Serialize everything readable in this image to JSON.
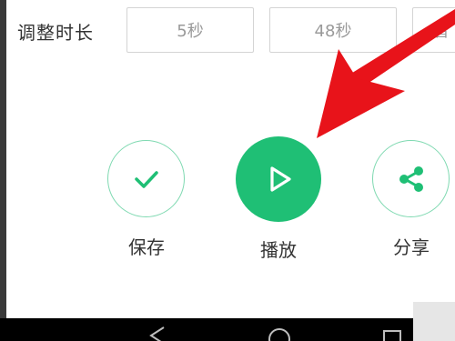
{
  "duration": {
    "label": "调整时长",
    "options": [
      "5秒",
      "48秒",
      "智"
    ]
  },
  "actions": {
    "save_label": "保存",
    "play_label": "播放",
    "share_label": "分享"
  },
  "colors": {
    "accent_green": "#1fbf75",
    "outline_green": "#7fd9b1",
    "arrow_red": "#e8131a",
    "text_dark": "#333333",
    "text_gray": "#9a9a9a"
  },
  "icons": {
    "save": "check-icon",
    "play": "play-icon",
    "share": "share-icon",
    "nav_back": "back-triangle-icon",
    "nav_home": "home-circle-icon",
    "nav_recent": "recent-square-icon"
  }
}
